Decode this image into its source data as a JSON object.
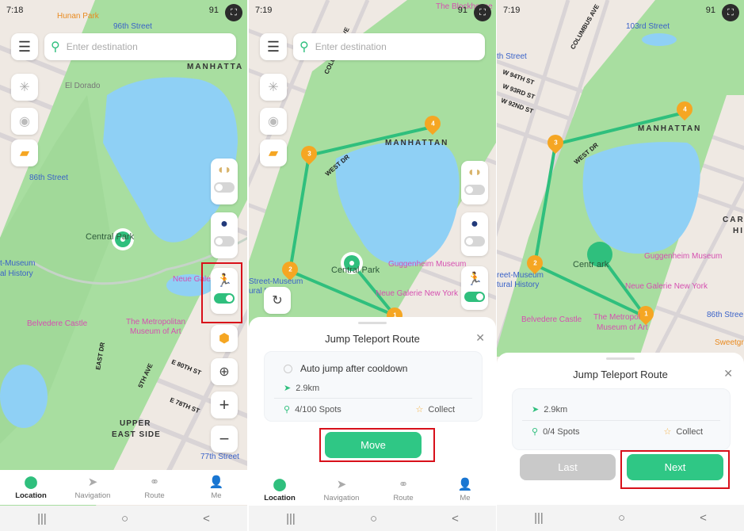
{
  "colors": {
    "accent": "#2fc785",
    "highlight": "#d8101a",
    "pin": "#f5a623",
    "park": "#a8dea0",
    "water": "#8fd0f5",
    "poi": "#d54fb0"
  },
  "status": [
    {
      "time": "7:18",
      "battery": "91"
    },
    {
      "time": "7:19",
      "battery": "91"
    },
    {
      "time": "7:19",
      "battery": "91"
    }
  ],
  "search": {
    "placeholder": "Enter destination",
    "icon": "search-icon"
  },
  "left_tools": [
    "joystick-icon",
    "pokeball-icon",
    "folder-icon"
  ],
  "right_tools": {
    "toggles": [
      {
        "icon": "gamepad-icon",
        "on": false
      },
      {
        "icon": "joystick-ball-icon",
        "on": false
      },
      {
        "icon": "jump-teleport-icon",
        "on": true
      }
    ],
    "buttons": [
      "hexagon-icon",
      "locate-icon",
      "zoom-in-icon",
      "zoom-out-icon"
    ]
  },
  "map1": {
    "labels": [
      "Hunan Park",
      "96th Street",
      "MANHATTA",
      "El Dorado",
      "86th Street",
      "Central Park",
      "t-Museum",
      "al History",
      "Neue Galer",
      "Belvedere Castle",
      "The Metropolitan",
      "Museum of Art",
      "EAST DR",
      "5TH AVE",
      "E 80TH ST",
      "E 78TH ST",
      "UPPER",
      "EAST SIDE",
      "77th Street"
    ]
  },
  "map2": {
    "labels": [
      "MANHATTAN",
      "WEST DR",
      "Central Park",
      "Guggenheim Museum",
      "Neue Galerie New York",
      "Street-Museum",
      "ural History",
      "The Blockhouse",
      "COLUMBUS AVE"
    ],
    "pins": [
      "1",
      "2",
      "3",
      "4"
    ]
  },
  "map3": {
    "labels": [
      "103rd Street",
      "th Street",
      "COLUMBUS AVE",
      "W 94TH ST",
      "W 93RD ST",
      "W 92ND ST",
      "MANHATTAN",
      "WEST DR",
      "CARN",
      "HI",
      "Guggenheim Museum",
      "Centr  ark",
      "reet-Museum",
      "tural History",
      "Neue Galerie New York",
      "Belvedere Castle",
      "The Metropol",
      "Museum of Art",
      "86th Stree",
      "Sweetgr"
    ],
    "pins": [
      "1",
      "2",
      "3",
      "4"
    ]
  },
  "tabs": [
    {
      "label": "Location",
      "icon": "location-pin-icon",
      "active": true
    },
    {
      "label": "Navigation",
      "icon": "navigation-arrow-icon"
    },
    {
      "label": "Route",
      "icon": "route-icon"
    },
    {
      "label": "Me",
      "icon": "person-icon"
    }
  ],
  "sheet2": {
    "title": "Jump Teleport Route",
    "auto_jump": "Auto jump after cooldown",
    "distance": "2.9km",
    "spots": "4/100 Spots",
    "collect": "Collect",
    "move": "Move"
  },
  "sheet3": {
    "title": "Jump Teleport Route",
    "distance": "2.9km",
    "spots": "0/4 Spots",
    "collect": "Collect",
    "last": "Last",
    "next": "Next"
  },
  "navbar": {
    "recents": "|||",
    "home": "○",
    "back": "<"
  }
}
